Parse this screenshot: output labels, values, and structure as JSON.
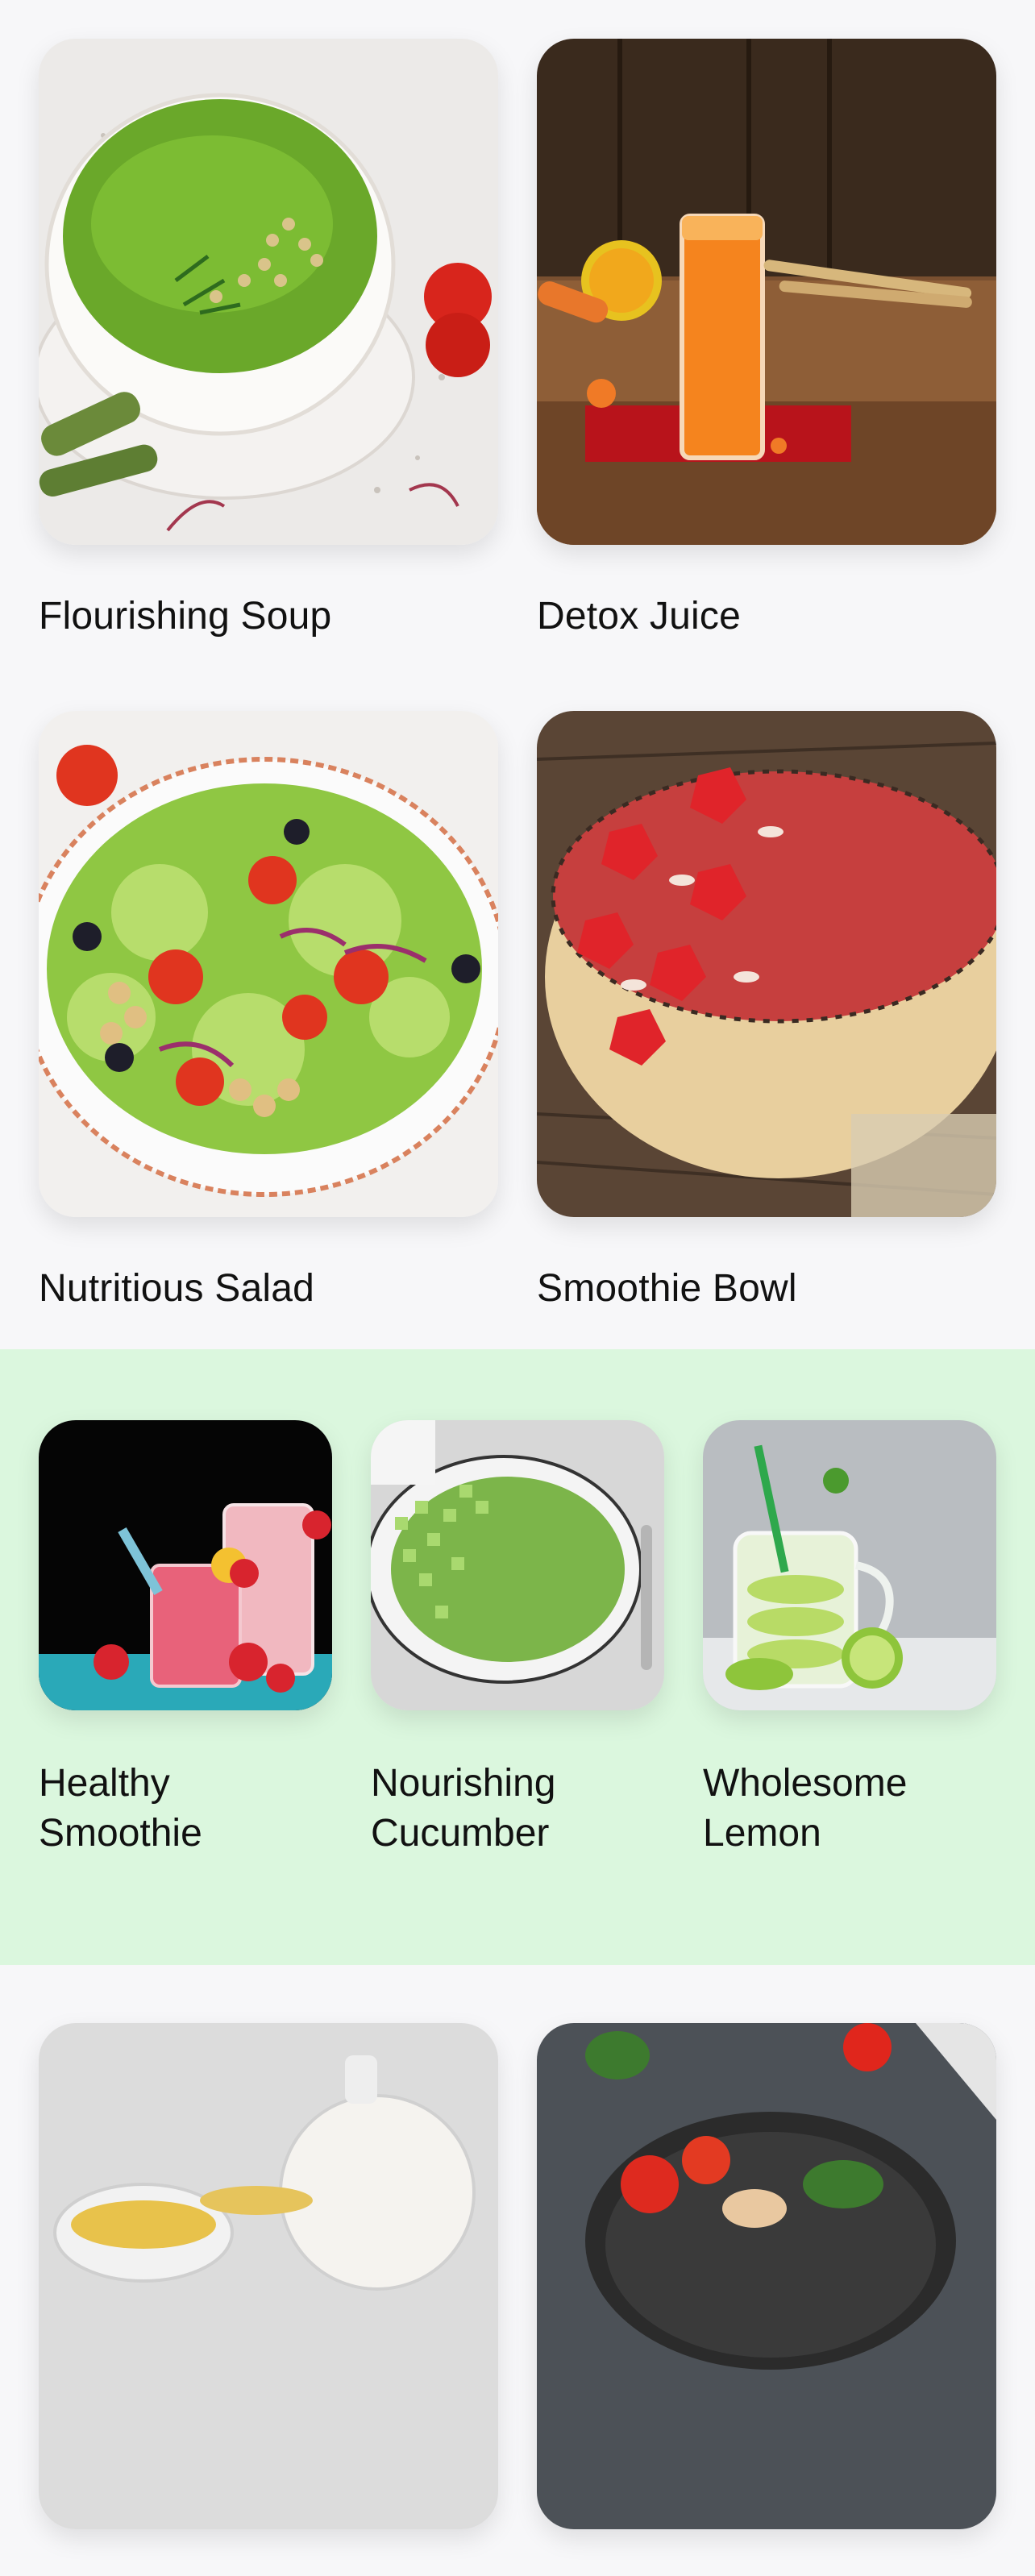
{
  "row1": {
    "items": [
      {
        "title": "Flourishing Soup",
        "image": "green-soup-bowl-photo"
      },
      {
        "title": "Detox Juice",
        "image": "orange-juice-glass-photo"
      }
    ]
  },
  "row2": {
    "items": [
      {
        "title": "Nutritious Salad",
        "image": "vegetable-salad-plate-photo"
      },
      {
        "title": "Smoothie Bowl",
        "image": "strawberry-smoothie-bowl-photo"
      }
    ]
  },
  "featured": {
    "background": "#dbf7de",
    "items": [
      {
        "title": "Healthy\nSmoothie",
        "image": "pink-smoothie-glasses-photo"
      },
      {
        "title": "Nourishing\nCucumber",
        "image": "cucumber-soup-bowl-photo"
      },
      {
        "title": "Wholesome\nLemon",
        "image": "lemon-water-jar-photo"
      }
    ]
  },
  "row4": {
    "items": [
      {
        "title": "",
        "image": "tea-cups-photo"
      },
      {
        "title": "",
        "image": "pan-with-vegetables-photo"
      }
    ]
  }
}
